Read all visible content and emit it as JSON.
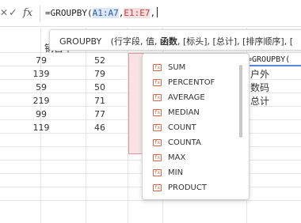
{
  "formula_bar": {
    "cancel_glyph": "✕",
    "confirm_glyph": "✓",
    "fx_label": "fx",
    "formula_prefix": "=GROUPBY(",
    "ref1": "A1:A7",
    "comma1": ",",
    "ref2": "E1:E7",
    "comma2": ","
  },
  "column_header_partial": "销售单",
  "columns": [
    {
      "values": [
        "79",
        "139",
        "59",
        "219",
        "99",
        "119"
      ]
    },
    {
      "values": [
        "52",
        "79",
        "50",
        "71",
        "77",
        "46"
      ]
    }
  ],
  "formula_cell": {
    "text": "=GROUPBY("
  },
  "result_cells": [
    "户外",
    "数码",
    "总计"
  ],
  "tooltip": {
    "function_name": "GROUPBY",
    "open": " (",
    "arg1": "行字段",
    "sep1": ", ",
    "arg2": "值",
    "sep2": ", ",
    "arg3": "函数",
    "rest": ", [标头], [总计], [排序顺序], ["
  },
  "autocomplete": {
    "icon_label": "fx",
    "items": [
      "SUM",
      "PERCENTOF",
      "AVERAGE",
      "MEDIAN",
      "COUNT",
      "COUNTA",
      "MAX",
      "MIN",
      "PRODUCT"
    ]
  },
  "colors": {
    "ref1": "#2f5da8",
    "ref2": "#b74040",
    "selection_fill": "#f8e4e4",
    "icon": "#d06a4b"
  }
}
